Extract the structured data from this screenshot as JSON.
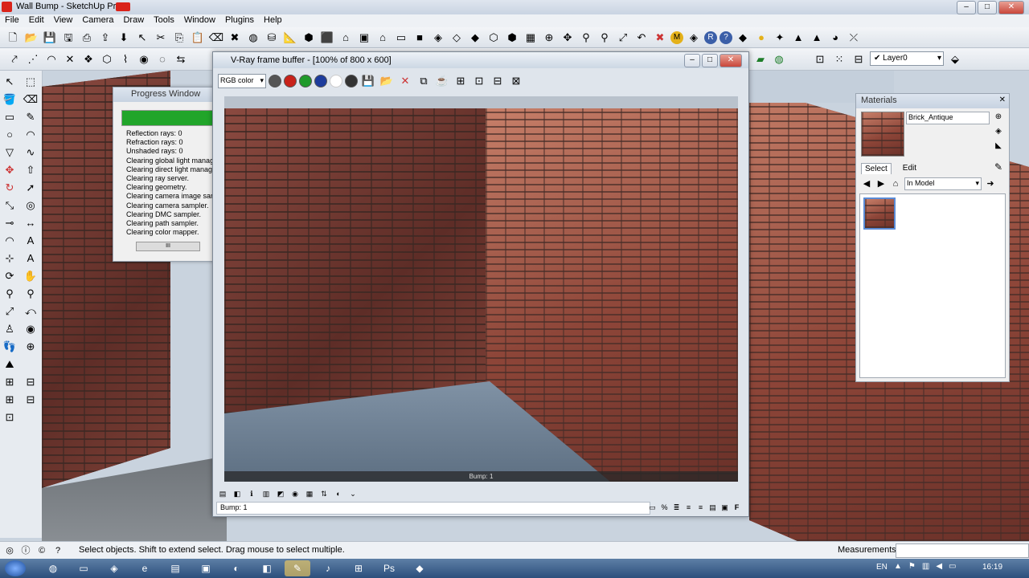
{
  "app": {
    "title": "Wall Bump - SketchUp Pro",
    "accent_red": "#d9231a"
  },
  "menu": [
    "File",
    "Edit",
    "View",
    "Camera",
    "Draw",
    "Tools",
    "Window",
    "Plugins",
    "Help"
  ],
  "window_controls": {
    "minimize": "–",
    "maximize": "□",
    "close": "✕"
  },
  "toolbar": {
    "layer_label": "Layer0"
  },
  "progress_window": {
    "title": "Progress Window",
    "progress_fraction": 1.0,
    "lines": [
      "Reflection rays: 0",
      "Refraction rays: 0",
      "Unshaded rays: 0",
      "Clearing global light manage",
      "Clearing direct light manage",
      "Clearing ray server.",
      "Clearing geometry.",
      "Clearing camera image samp",
      "Clearing camera sampler.",
      "Clearing DMC sampler.",
      "Clearing path sampler.",
      "Clearing color mapper."
    ],
    "scroll_grip": "III"
  },
  "vfb": {
    "title": "V-Ray frame buffer - [100% of 800 x 600]",
    "channel": "RGB color",
    "render_label": "Bump: 1",
    "status": "Bump: 1",
    "colors": {
      "red": "#c8221a",
      "green": "#1f9a2a",
      "blue": "#1d3c9c"
    },
    "bottom_icons": [
      "%",
      "F"
    ]
  },
  "materials": {
    "title": "Materials",
    "name": "Brick_Antique",
    "tabs": [
      "Select",
      "Edit"
    ],
    "collection": "In Model"
  },
  "statusbar": {
    "hint": "Select objects. Shift to extend select. Drag mouse to select multiple.",
    "measurements_label": "Measurements"
  },
  "taskbar": {
    "lang": "EN",
    "clock": "16:19"
  }
}
